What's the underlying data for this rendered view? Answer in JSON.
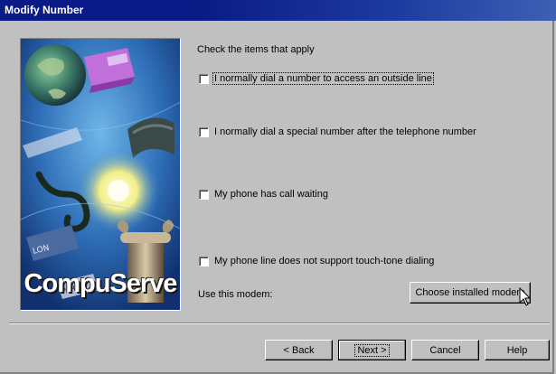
{
  "window": {
    "title": "Modify Number"
  },
  "artwork": {
    "logo_text": "CompuServe"
  },
  "options": {
    "heading": "Check the items that apply",
    "items": [
      {
        "label": "I normally dial a number to access an outside line",
        "checked": false
      },
      {
        "label": "I normally dial a special number after the telephone number",
        "checked": false
      },
      {
        "label": "My phone has call waiting",
        "checked": false
      },
      {
        "label": "My phone line does not support touch-tone dialing",
        "checked": false
      }
    ]
  },
  "modem": {
    "label": "Use this modem:",
    "button_label": "Choose installed modem"
  },
  "footer": {
    "back_label": "< Back",
    "next_label": "Next >",
    "cancel_label": "Cancel",
    "help_label": "Help"
  }
}
